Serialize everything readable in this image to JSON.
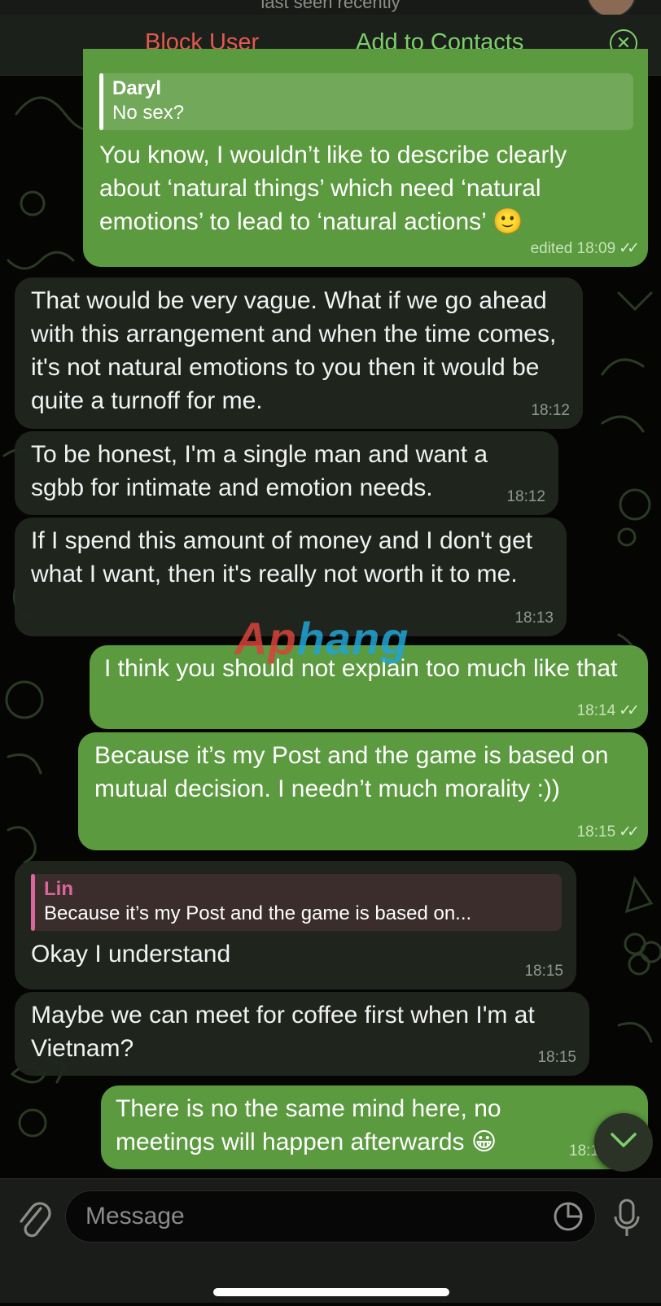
{
  "header": {
    "last_seen": "last seen recently",
    "block_label": "Block User",
    "add_label": "Add to Contacts",
    "close_icon": "close-circle-icon"
  },
  "messages": [
    {
      "dir": "out",
      "reply_name": "Daryl",
      "reply_text": "No sex?",
      "text": "You know, I wouldn’t like to describe clearly about ‘natural things’ which need ‘natural emotions’ to lead to ‘natural actions’ 🙂",
      "time": "edited 18:09",
      "read": true
    },
    {
      "dir": "in",
      "text": "That would be very vague. What if we go ahead with this arrangement and when the time comes, it's not natural emotions to you then it would be quite a turnoff for me.",
      "time": "18:12"
    },
    {
      "dir": "in",
      "text": "To be honest, I'm a single man and want a sgbb for intimate and emotion needs.",
      "time": "18:12"
    },
    {
      "dir": "in",
      "text": "If I spend this amount of money and I don't get what I want, then it's really not worth it to me.",
      "time": "18:13"
    },
    {
      "dir": "out",
      "text": "I think you should not explain too much like that",
      "time": "18:14",
      "read": true
    },
    {
      "dir": "out",
      "text": "Because it’s my Post and the game is based on mutual decision. I needn’t much morality :))",
      "time": "18:15",
      "read": true
    },
    {
      "dir": "in",
      "reply_name": "Lin",
      "reply_text": "Because it’s my Post and the game is based on...",
      "text": "Okay I understand",
      "time": "18:15"
    },
    {
      "dir": "in",
      "text": "Maybe we can meet for coffee first when I'm at Vietnam?",
      "time": "18:15"
    },
    {
      "dir": "out",
      "text": "There is no the same mind here, no meetings will happen afterwards 😀",
      "time": "18:1"
    }
  ],
  "watermark": {
    "part1": "Ap",
    "part2": "hang"
  },
  "composer": {
    "placeholder": "Message",
    "attach_icon": "paperclip-icon",
    "sticker_icon": "sticker-icon",
    "mic_icon": "microphone-icon"
  },
  "colors": {
    "outgoing_bubble": "#5b9a3f",
    "incoming_bubble": "#20261e",
    "accent_green": "#7ccf6a",
    "block_red": "#e05a4f",
    "reply_pink": "#d9679c"
  }
}
